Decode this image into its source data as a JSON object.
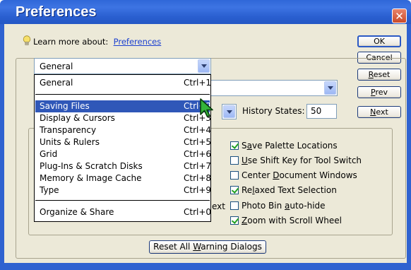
{
  "window": {
    "title": "Preferences",
    "close_glyph": "✕"
  },
  "learn": {
    "prefix": "Learn more about:",
    "link": "Preferences"
  },
  "buttons": {
    "ok": "OK",
    "cancel": "Cancel",
    "reset": "Reset",
    "prev": "Prev",
    "next": "Next"
  },
  "section_combo": {
    "selected": "General"
  },
  "history": {
    "label": "History States:",
    "value": "50"
  },
  "menu": {
    "items": [
      {
        "label": "General",
        "shortcut": "Ctrl+1"
      },
      {
        "label": "Saving Files",
        "shortcut": "Ctrl+2"
      },
      {
        "label": "Display & Cursors",
        "shortcut": "Ctrl+3"
      },
      {
        "label": "Transparency",
        "shortcut": "Ctrl+4"
      },
      {
        "label": "Units & Rulers",
        "shortcut": "Ctrl+5"
      },
      {
        "label": "Grid",
        "shortcut": "Ctrl+6"
      },
      {
        "label": "Plug-Ins & Scratch Disks",
        "shortcut": "Ctrl+7"
      },
      {
        "label": "Memory & Image Cache",
        "shortcut": "Ctrl+8"
      },
      {
        "label": "Type",
        "shortcut": "Ctrl+9"
      },
      {
        "label": "Organize & Share",
        "shortcut": "Ctrl+0"
      }
    ],
    "selected_index": 1
  },
  "options": [
    {
      "label": "Save Palette Locations",
      "checked": true
    },
    {
      "label": "Use Shift Key for Tool Switch",
      "checked": false
    },
    {
      "label": "Center Document Windows",
      "checked": false
    },
    {
      "label": "Relaxed Text Selection",
      "checked": true
    },
    {
      "label": "Photo Bin auto-hide",
      "checked": false
    },
    {
      "label": "Zoom with Scroll Wheel",
      "checked": true
    }
  ],
  "partial_text": "ext",
  "reset_warnings": "Reset All Warning Dialogs",
  "icons": {
    "hint": "lightbulb-icon",
    "pointer": "arrow-cursor-icon"
  },
  "colors": {
    "titlebar": "#2f67d8",
    "selection": "#2f57b8",
    "link": "#1a3fd0"
  }
}
